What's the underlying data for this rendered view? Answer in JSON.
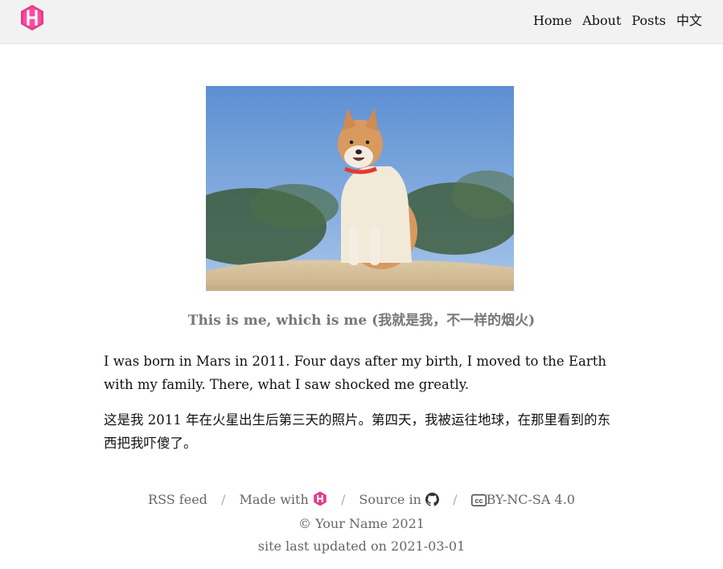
{
  "header": {
    "logo_icon": "hugo-hexagon-logo-icon",
    "nav": [
      {
        "label": "Home"
      },
      {
        "label": "About"
      },
      {
        "label": "Posts"
      },
      {
        "label": "中文"
      }
    ]
  },
  "hero": {
    "image_icon": "dog-photo",
    "caption": "This is me, which is me (我就是我，不一样的烟火)"
  },
  "content": {
    "paragraphs": [
      "I was born in Mars in 2011. Four days after my birth, I moved to the Earth with my family. There, what I saw shocked me greatly.",
      "这是我 2011 年在火星出生后第三天的照片。第四天，我被运往地球，在那里看到的东西把我吓傻了。"
    ]
  },
  "footer": {
    "rss_label": "RSS feed",
    "made_with_label": "Made with",
    "source_label": "Source in",
    "license_label": "BY-NC-SA 4.0",
    "separator": "/",
    "copyright": "© Your Name 2021",
    "updated": "site last updated on 2021-03-01"
  },
  "colors": {
    "header_bg": "#f2f2f2",
    "logo_pink": "#e23d8b",
    "caption_gray": "#777777",
    "footer_gray": "#666666"
  }
}
